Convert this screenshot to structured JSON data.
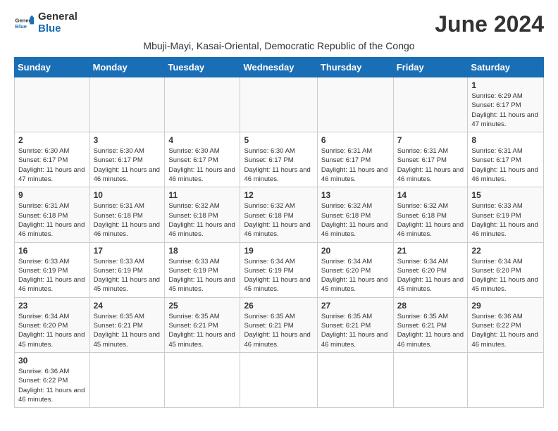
{
  "header": {
    "logo_general": "General",
    "logo_blue": "Blue",
    "month_title": "June 2024",
    "subtitle": "Mbuji-Mayi, Kasai-Oriental, Democratic Republic of the Congo"
  },
  "weekdays": [
    "Sunday",
    "Monday",
    "Tuesday",
    "Wednesday",
    "Thursday",
    "Friday",
    "Saturday"
  ],
  "weeks": [
    [
      {
        "day": "",
        "info": ""
      },
      {
        "day": "",
        "info": ""
      },
      {
        "day": "",
        "info": ""
      },
      {
        "day": "",
        "info": ""
      },
      {
        "day": "",
        "info": ""
      },
      {
        "day": "",
        "info": ""
      },
      {
        "day": "1",
        "info": "Sunrise: 6:29 AM\nSunset: 6:17 PM\nDaylight: 11 hours and 47 minutes."
      }
    ],
    [
      {
        "day": "2",
        "info": "Sunrise: 6:30 AM\nSunset: 6:17 PM\nDaylight: 11 hours and 47 minutes."
      },
      {
        "day": "3",
        "info": "Sunrise: 6:30 AM\nSunset: 6:17 PM\nDaylight: 11 hours and 46 minutes."
      },
      {
        "day": "4",
        "info": "Sunrise: 6:30 AM\nSunset: 6:17 PM\nDaylight: 11 hours and 46 minutes."
      },
      {
        "day": "5",
        "info": "Sunrise: 6:30 AM\nSunset: 6:17 PM\nDaylight: 11 hours and 46 minutes."
      },
      {
        "day": "6",
        "info": "Sunrise: 6:31 AM\nSunset: 6:17 PM\nDaylight: 11 hours and 46 minutes."
      },
      {
        "day": "7",
        "info": "Sunrise: 6:31 AM\nSunset: 6:17 PM\nDaylight: 11 hours and 46 minutes."
      },
      {
        "day": "8",
        "info": "Sunrise: 6:31 AM\nSunset: 6:17 PM\nDaylight: 11 hours and 46 minutes."
      }
    ],
    [
      {
        "day": "9",
        "info": "Sunrise: 6:31 AM\nSunset: 6:18 PM\nDaylight: 11 hours and 46 minutes."
      },
      {
        "day": "10",
        "info": "Sunrise: 6:31 AM\nSunset: 6:18 PM\nDaylight: 11 hours and 46 minutes."
      },
      {
        "day": "11",
        "info": "Sunrise: 6:32 AM\nSunset: 6:18 PM\nDaylight: 11 hours and 46 minutes."
      },
      {
        "day": "12",
        "info": "Sunrise: 6:32 AM\nSunset: 6:18 PM\nDaylight: 11 hours and 46 minutes."
      },
      {
        "day": "13",
        "info": "Sunrise: 6:32 AM\nSunset: 6:18 PM\nDaylight: 11 hours and 46 minutes."
      },
      {
        "day": "14",
        "info": "Sunrise: 6:32 AM\nSunset: 6:18 PM\nDaylight: 11 hours and 46 minutes."
      },
      {
        "day": "15",
        "info": "Sunrise: 6:33 AM\nSunset: 6:19 PM\nDaylight: 11 hours and 46 minutes."
      }
    ],
    [
      {
        "day": "16",
        "info": "Sunrise: 6:33 AM\nSunset: 6:19 PM\nDaylight: 11 hours and 46 minutes."
      },
      {
        "day": "17",
        "info": "Sunrise: 6:33 AM\nSunset: 6:19 PM\nDaylight: 11 hours and 45 minutes."
      },
      {
        "day": "18",
        "info": "Sunrise: 6:33 AM\nSunset: 6:19 PM\nDaylight: 11 hours and 45 minutes."
      },
      {
        "day": "19",
        "info": "Sunrise: 6:34 AM\nSunset: 6:19 PM\nDaylight: 11 hours and 45 minutes."
      },
      {
        "day": "20",
        "info": "Sunrise: 6:34 AM\nSunset: 6:20 PM\nDaylight: 11 hours and 45 minutes."
      },
      {
        "day": "21",
        "info": "Sunrise: 6:34 AM\nSunset: 6:20 PM\nDaylight: 11 hours and 45 minutes."
      },
      {
        "day": "22",
        "info": "Sunrise: 6:34 AM\nSunset: 6:20 PM\nDaylight: 11 hours and 45 minutes."
      }
    ],
    [
      {
        "day": "23",
        "info": "Sunrise: 6:34 AM\nSunset: 6:20 PM\nDaylight: 11 hours and 45 minutes."
      },
      {
        "day": "24",
        "info": "Sunrise: 6:35 AM\nSunset: 6:21 PM\nDaylight: 11 hours and 45 minutes."
      },
      {
        "day": "25",
        "info": "Sunrise: 6:35 AM\nSunset: 6:21 PM\nDaylight: 11 hours and 45 minutes."
      },
      {
        "day": "26",
        "info": "Sunrise: 6:35 AM\nSunset: 6:21 PM\nDaylight: 11 hours and 46 minutes."
      },
      {
        "day": "27",
        "info": "Sunrise: 6:35 AM\nSunset: 6:21 PM\nDaylight: 11 hours and 46 minutes."
      },
      {
        "day": "28",
        "info": "Sunrise: 6:35 AM\nSunset: 6:21 PM\nDaylight: 11 hours and 46 minutes."
      },
      {
        "day": "29",
        "info": "Sunrise: 6:36 AM\nSunset: 6:22 PM\nDaylight: 11 hours and 46 minutes."
      }
    ],
    [
      {
        "day": "30",
        "info": "Sunrise: 6:36 AM\nSunset: 6:22 PM\nDaylight: 11 hours and 46 minutes."
      },
      {
        "day": "",
        "info": ""
      },
      {
        "day": "",
        "info": ""
      },
      {
        "day": "",
        "info": ""
      },
      {
        "day": "",
        "info": ""
      },
      {
        "day": "",
        "info": ""
      },
      {
        "day": "",
        "info": ""
      }
    ]
  ]
}
